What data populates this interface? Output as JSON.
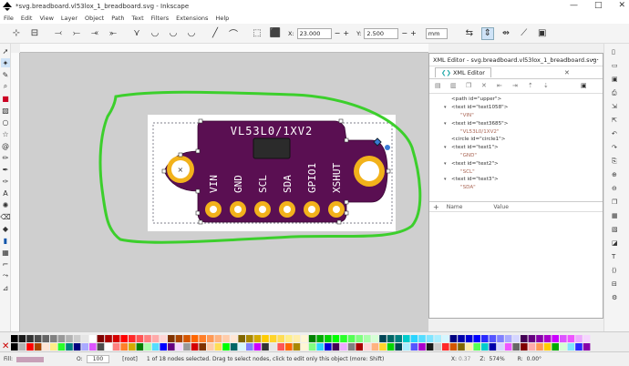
{
  "window": {
    "title": "*svg.breadboard.vl53lox_1_breadboard.svg - Inkscape",
    "minimize": "—",
    "maximize": "□",
    "close": "✕"
  },
  "menu": [
    "File",
    "Edit",
    "View",
    "Layer",
    "Object",
    "Path",
    "Text",
    "Filters",
    "Extensions",
    "Help"
  ],
  "toolbar": {
    "x_label": "X:",
    "x_value": "23.000",
    "y_label": "Y:",
    "y_value": "2.500",
    "unit": "mm",
    "plus": "+",
    "minus": "−"
  },
  "board": {
    "title": "VL53L0/1XV2",
    "pins": [
      "VIN",
      "GND",
      "SCL",
      "SDA",
      "GPIO1",
      "XSHUT"
    ],
    "color": "#5a0f52",
    "pad_color": "#f2b21b"
  },
  "annotation": {
    "color": "#3ccf2c"
  },
  "xml_editor": {
    "title": "XML Editor - svg.breadboard.vl53lox_1_breadboard.svg",
    "tab": "XML Editor",
    "tab_close": "✕",
    "nodes": [
      {
        "kind": "node",
        "text": "<path id=\"upper\">",
        "expand": ""
      },
      {
        "kind": "node",
        "text": "<text id=\"text1058\">",
        "expand": "▾"
      },
      {
        "kind": "attr",
        "text": "\"VIN\""
      },
      {
        "kind": "node",
        "text": "<text id=\"text3685\">",
        "expand": "▾"
      },
      {
        "kind": "attr",
        "text": "\"VL53L0/1XV2\""
      },
      {
        "kind": "node",
        "text": "<circle id=\"circle1\">",
        "expand": ""
      },
      {
        "kind": "node",
        "text": "<text id=\"text1\">",
        "expand": "▾"
      },
      {
        "kind": "attr",
        "text": "\"GND\""
      },
      {
        "kind": "node",
        "text": "<text id=\"text2\">",
        "expand": "▾"
      },
      {
        "kind": "attr",
        "text": "\"SCL\""
      },
      {
        "kind": "node",
        "text": "<text id=\"text3\">",
        "expand": "▾"
      },
      {
        "kind": "attr",
        "text": "\"SDA\""
      }
    ],
    "attr_headers": {
      "name": "Name",
      "value": "Value"
    },
    "add_icon": "+"
  },
  "status": {
    "fill_label": "Fill:",
    "stroke_label": "S:",
    "opacity_label": "O:",
    "opacity_value": "100",
    "layer": "[root]",
    "message": "1 of 18 nodes selected. Drag to select nodes, click to edit only this object (more: Shift)",
    "x_label": "X:",
    "x_value": "0.37",
    "y_label": "Y:",
    "y_value": "-0.75",
    "zoom_label": "Z:",
    "zoom_value": "574%",
    "rotate_label": "R:",
    "rotate_value": "0.00°"
  }
}
